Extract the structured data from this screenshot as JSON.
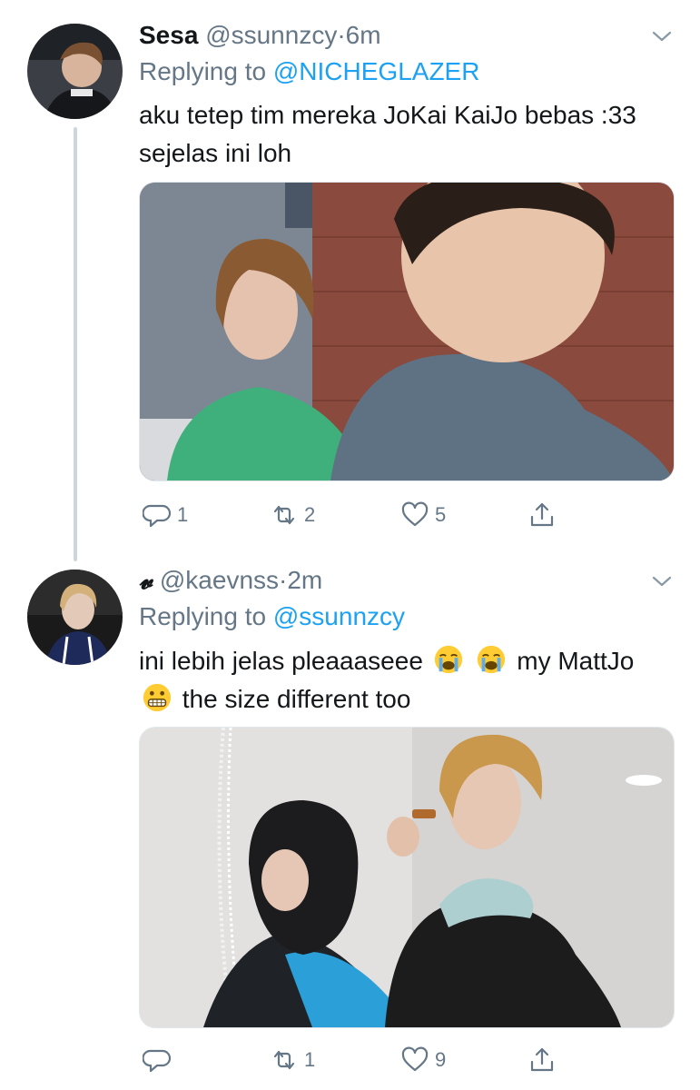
{
  "tweets": [
    {
      "name": "Sesa",
      "handle": "@ssunnzcy",
      "separator": "·",
      "time": "6m",
      "replying_prefix": "Replying to",
      "replying_to": "@NICHEGLAZER",
      "text": "aku tetep tim mereka JoKai KaiJo bebas :33 sejelas ini loh",
      "counts": {
        "reply": "1",
        "retweet": "2",
        "like": "5"
      }
    },
    {
      "name": "𝓿",
      "handle": "@kaevnss",
      "separator": "·",
      "time": "2m",
      "replying_prefix": "Replying to",
      "replying_to": "@ssunnzcy",
      "text_part1": "ini lebih jelas pleaaaseee",
      "text_part2": "my MattJo",
      "text_part3": "the size different too",
      "emojis": [
        "loudly-crying-face",
        "loudly-crying-face",
        "grimacing-face"
      ],
      "counts": {
        "reply": "",
        "retweet": "1",
        "like": "9"
      }
    }
  ],
  "icons": [
    "reply-icon",
    "retweet-icon",
    "like-icon",
    "share-icon",
    "chevron-down-icon"
  ],
  "colors": {
    "link": "#1da1f2",
    "muted": "#657786",
    "thread_line": "#cdd6dd"
  }
}
